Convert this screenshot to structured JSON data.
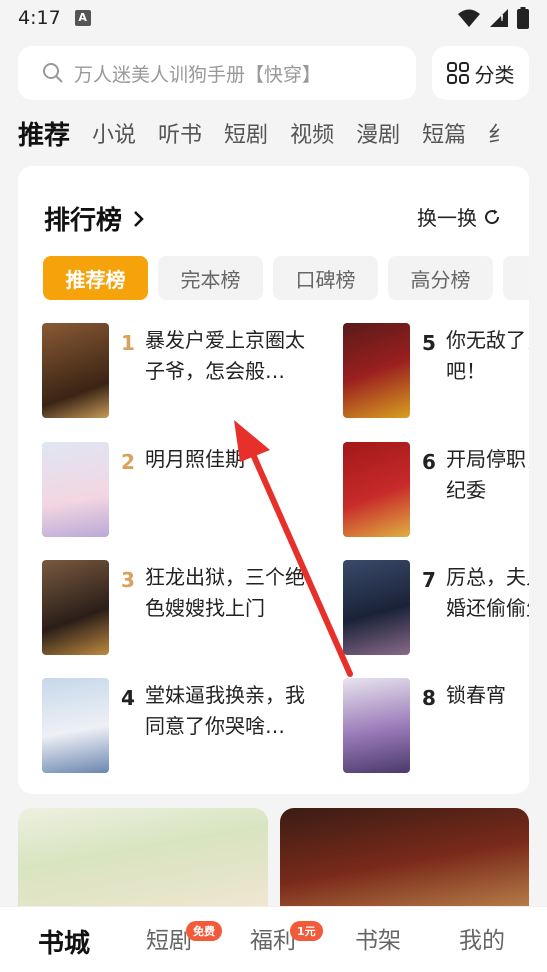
{
  "status_bar": {
    "time": "4:17"
  },
  "search": {
    "placeholder": "万人迷美人训狗手册【快穿】"
  },
  "category_button": {
    "label": "分类"
  },
  "tabs": [
    {
      "label": "推荐"
    },
    {
      "label": "小说"
    },
    {
      "label": "听书"
    },
    {
      "label": "短剧"
    },
    {
      "label": "视频"
    },
    {
      "label": "漫剧"
    },
    {
      "label": "短篇"
    },
    {
      "label": "纟"
    }
  ],
  "ranking": {
    "title": "排行榜",
    "refresh_label": "换一换",
    "subtabs": [
      {
        "label": "推荐榜"
      },
      {
        "label": "完本榜"
      },
      {
        "label": "口碑榜"
      },
      {
        "label": "高分榜"
      }
    ],
    "books": [
      {
        "rank": "1",
        "title": "暴发户爱上京圈太子爷，怎会般…"
      },
      {
        "rank": "2",
        "title": "明月照佳期"
      },
      {
        "rank": "3",
        "title": "狂龙出狱，三个绝色嫂嫂找上门"
      },
      {
        "rank": "4",
        "title": "堂妹逼我换亲，我同意了你哭啥…"
      },
      {
        "rank": "5",
        "title": "你无敌了，下山去吧！"
      },
      {
        "rank": "6",
        "title": "开局停职，转身投纪委"
      },
      {
        "rank": "7",
        "title": "厉总，夫人不想复婚还偷偷生崽了"
      },
      {
        "rank": "8",
        "title": "锁春宵"
      }
    ]
  },
  "bottom_nav": [
    {
      "label": "书城"
    },
    {
      "label": "短剧",
      "badge": "免费"
    },
    {
      "label": "福利",
      "badge": "1元"
    },
    {
      "label": "书架"
    },
    {
      "label": "我的"
    }
  ],
  "colors": {
    "accent": "#f5a20b",
    "top_rank": "#d8a25e",
    "arrow": "#e8302a",
    "badge": "#f25a3a"
  }
}
